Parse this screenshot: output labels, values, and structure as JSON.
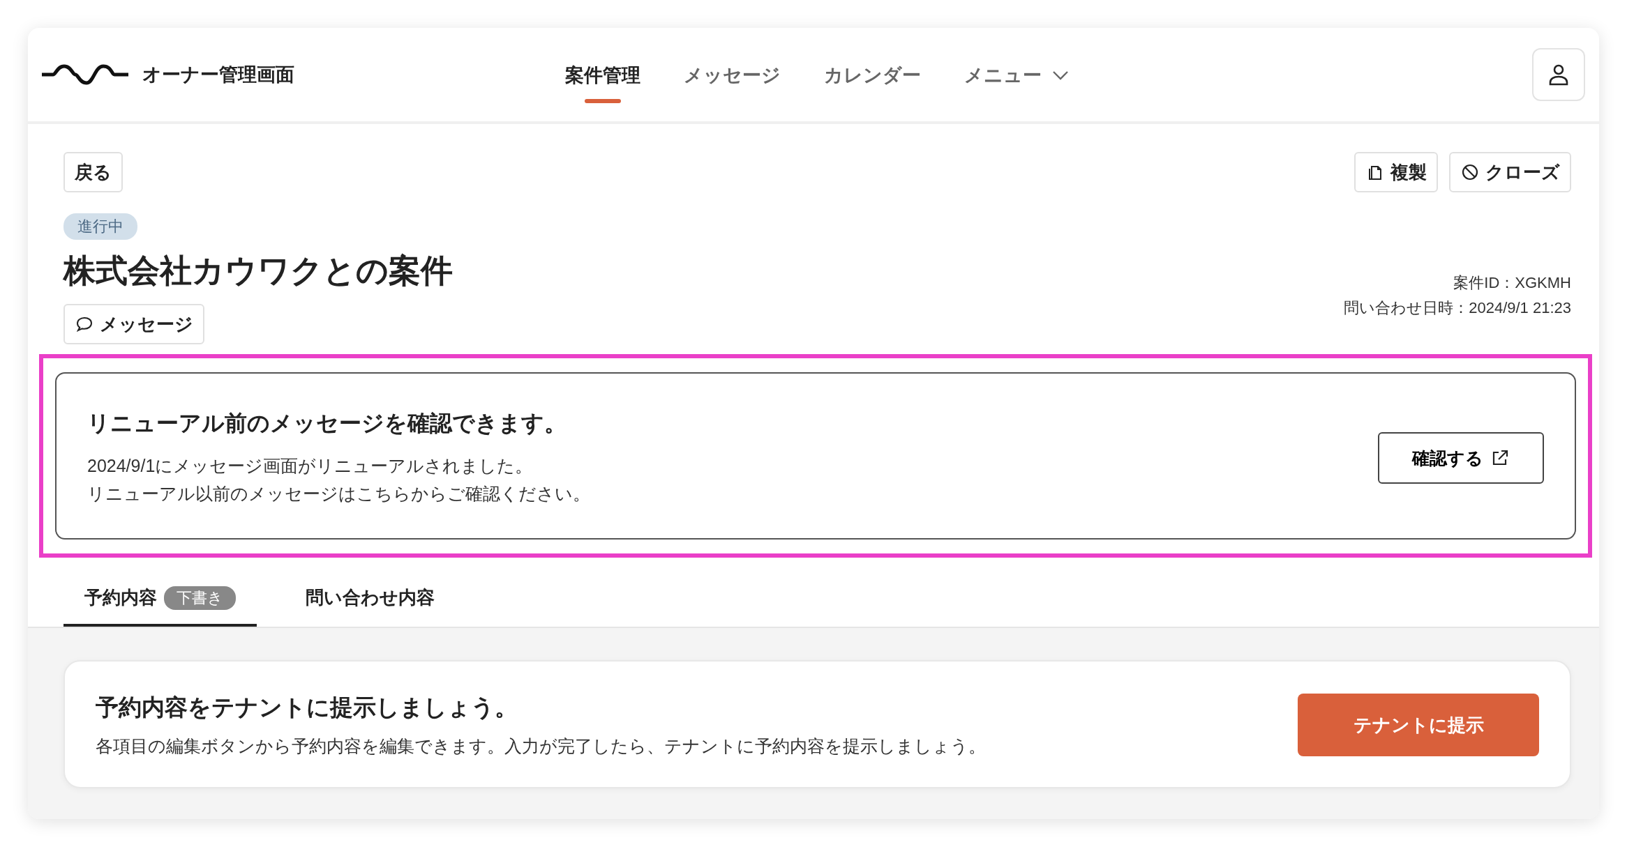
{
  "header": {
    "app_title": "オーナー管理画面",
    "nav": [
      {
        "label": "案件管理",
        "selected": true,
        "kind": "link"
      },
      {
        "label": "メッセージ",
        "selected": false,
        "kind": "link"
      },
      {
        "label": "カレンダー",
        "selected": false,
        "kind": "link"
      },
      {
        "label": "メニュー",
        "selected": false,
        "kind": "dropdown"
      }
    ]
  },
  "toolbar": {
    "back": "戻る",
    "actions": [
      {
        "label": "複製",
        "kind": "duplicate"
      },
      {
        "label": "クローズ",
        "kind": "close"
      }
    ]
  },
  "case": {
    "status": "進行中",
    "title": "株式会社カウワクとの案件",
    "message_button": "メッセージ",
    "case_id": "案件ID：XGKMH",
    "inquiry_datetime": "問い合わせ日時：2024/9/1 21:23"
  },
  "notice": {
    "highlighted": true,
    "title": "リニューアル前のメッセージを確認できます。",
    "lines": [
      "2024/9/1にメッセージ画面がリニューアルされました。",
      "リニューアル以前のメッセージはこちらからご確認ください。"
    ],
    "button": "確認する"
  },
  "tabs": [
    {
      "label": "予約内容",
      "badge": "下書き",
      "selected": true
    },
    {
      "label": "問い合わせ内容",
      "selected": false
    }
  ],
  "prompt": {
    "title": "予約内容をテナントに提示しましょう。",
    "text": "各項目の編集ボタンから予約内容を編集できます。入力が完了したら、テナントに予約内容を提示しましょう。",
    "button": "テナントに提示"
  }
}
